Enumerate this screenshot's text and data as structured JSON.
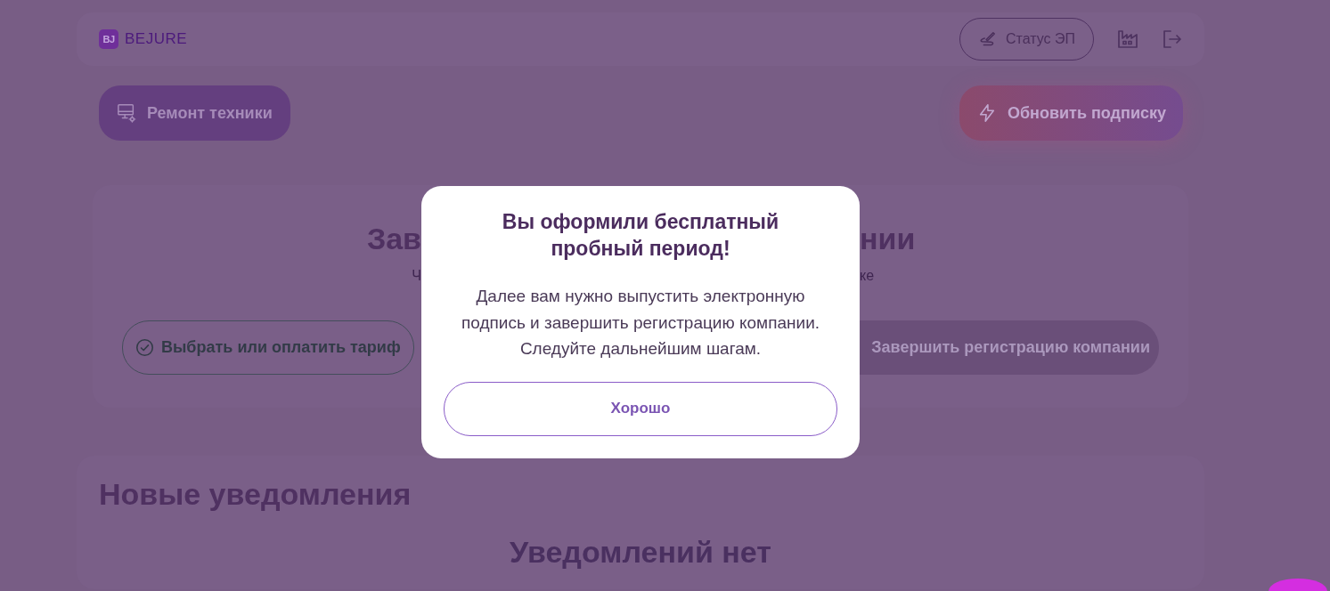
{
  "header": {
    "logo": {
      "mark": "BJ",
      "name": "BEJURE"
    },
    "ep_status_button": {
      "label": "Статус ЭП"
    }
  },
  "actions": {
    "repair_button": {
      "label": "Ремонт техники"
    },
    "upgrade_button": {
      "label": "Обновить подписку"
    }
  },
  "registration_card": {
    "title_parts": [
      "Зав",
      "нии"
    ],
    "subtitle_parts": [
      "Ч",
      "ке"
    ],
    "buttons": [
      {
        "kind": "outline",
        "label": "Выбрать или оплатить тариф"
      },
      {
        "kind": "filled",
        "label": "Завершить регистрацию компании"
      }
    ]
  },
  "notifications": {
    "title": "Новые уведомления",
    "empty_text": "Уведомлений нет"
  },
  "modal": {
    "title": "Вы оформили бесплатный пробный период!",
    "text": "Далее вам нужно выпустить электронную подпись и завершить регистрацию компании. Следуйте дальнейшим шагам.",
    "button": "Хорошо"
  }
}
